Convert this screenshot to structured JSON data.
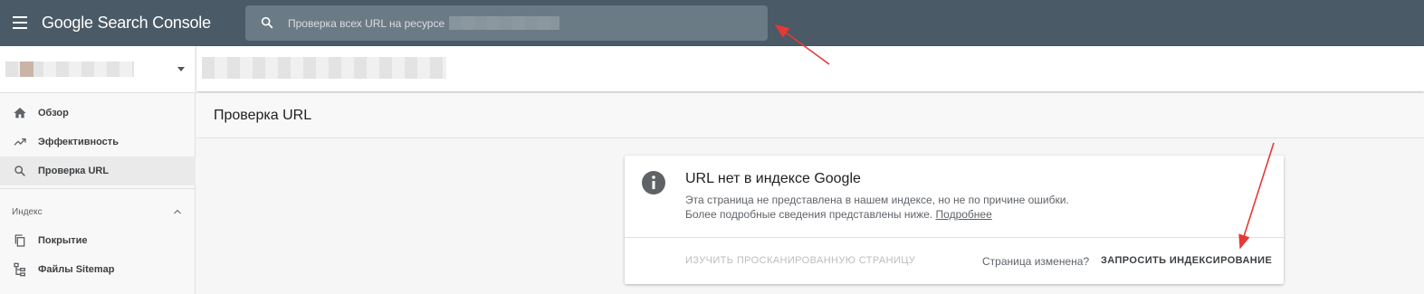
{
  "app": {
    "title": "Google Search Console"
  },
  "search": {
    "placeholder": "Проверка всех URL на ресурсе"
  },
  "sidebar": {
    "items": [
      {
        "label": "Обзор"
      },
      {
        "label": "Эффективность"
      },
      {
        "label": "Проверка URL"
      }
    ],
    "section_title": "Индекс",
    "section_items": [
      {
        "label": "Покрытие"
      },
      {
        "label": "Файлы Sitemap"
      }
    ]
  },
  "main": {
    "page_title": "Проверка URL",
    "card": {
      "title": "URL нет в индексе Google",
      "desc_line1": "Эта страница не представлена в нашем индексе, но не по причине ошибки.",
      "desc_line2": "Более подробные сведения представлены ниже.",
      "link": "Подробнее",
      "view_crawled": "ИЗУЧИТЬ ПРОСКАНИРОВАННУЮ СТРАНИЦУ",
      "page_changed": "Страница изменена?",
      "request_indexing": "ЗАПРОСИТЬ ИНДЕКСИРОВАНИЕ"
    }
  },
  "colors": {
    "topbar": "#4a5a66",
    "searchbox": "#6b7b86",
    "annotation": "#e53935"
  },
  "icons": [
    "menu-icon",
    "search-icon",
    "home-icon",
    "trending-icon",
    "search-icon",
    "chevron-up-icon",
    "pages-icon",
    "sitemap-icon",
    "info-icon"
  ]
}
